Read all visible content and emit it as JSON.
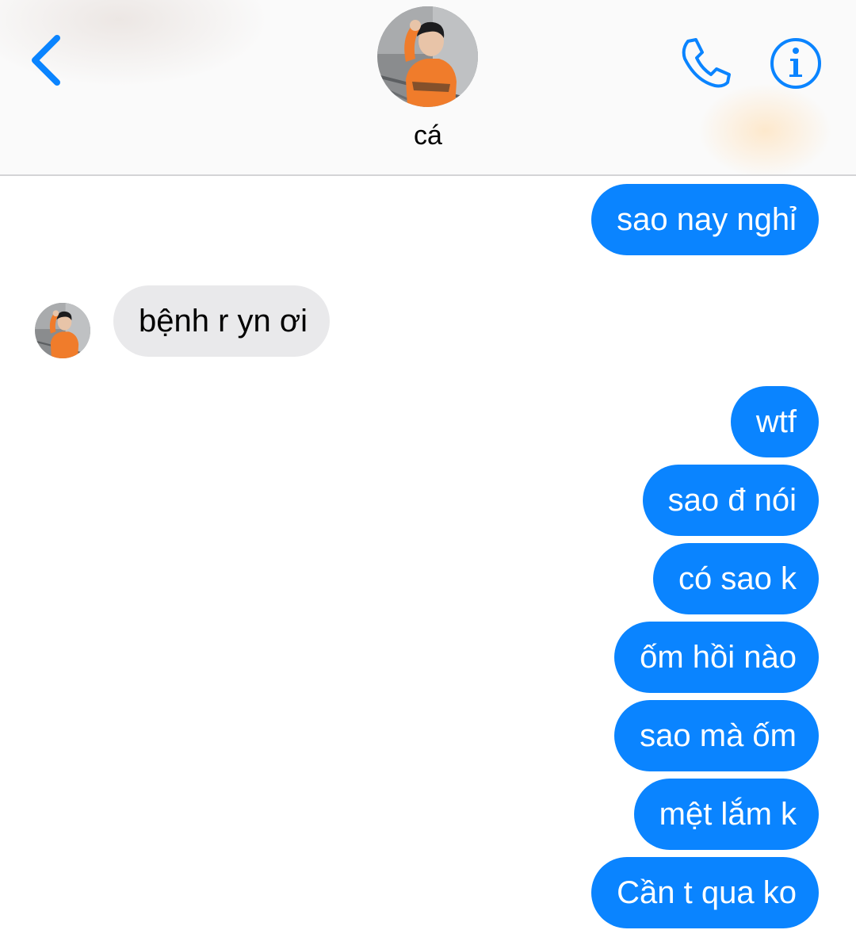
{
  "header": {
    "contact_name": "cá",
    "back_icon": "chevron-left-icon",
    "call_icon": "phone-icon",
    "info_icon": "info-icon",
    "accent_color": "#0a84ff"
  },
  "messages": [
    {
      "direction": "outgoing",
      "text": "sao nay nghỉ"
    },
    {
      "direction": "incoming",
      "text": "bệnh r yn ơi"
    },
    {
      "direction": "outgoing",
      "text": "wtf"
    },
    {
      "direction": "outgoing",
      "text": "sao đ nói"
    },
    {
      "direction": "outgoing",
      "text": "có sao k"
    },
    {
      "direction": "outgoing",
      "text": "ốm hồi nào"
    },
    {
      "direction": "outgoing",
      "text": "sao mà ốm"
    },
    {
      "direction": "outgoing",
      "text": "mệt lắm k"
    },
    {
      "direction": "outgoing",
      "text": "Cần t qua ko"
    }
  ],
  "colors": {
    "outgoing_bubble": "#0a84ff",
    "incoming_bubble": "#e9e9eb"
  }
}
